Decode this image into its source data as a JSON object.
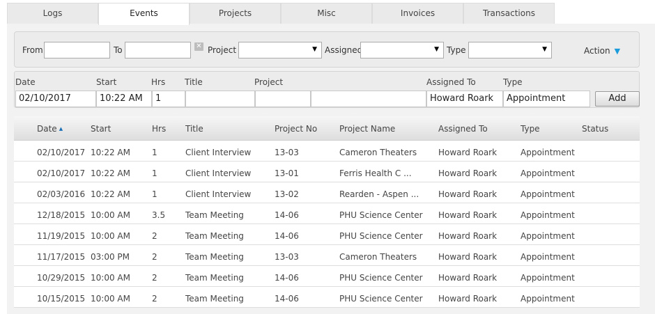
{
  "tabs": [
    "Logs",
    "Events",
    "Projects",
    "Misc",
    "Invoices",
    "Transactions"
  ],
  "active_tab": "Events",
  "filter": {
    "from_label": "From",
    "from_value": "",
    "to_label": "To",
    "to_value": "",
    "clear_icon": "close-icon",
    "project_label": "Project",
    "project_value": "",
    "assigned_label": "Assigned",
    "assigned_value": "",
    "type_label": "Type",
    "type_value": "",
    "action_label": "Action",
    "accent": "#1a9bdc"
  },
  "add_form": {
    "labels": {
      "date": "Date",
      "start": "Start",
      "hrs": "Hrs",
      "title": "Title",
      "project": "Project",
      "assigned": "Assigned To",
      "type": "Type"
    },
    "values": {
      "date": "02/10/2017",
      "start": "10:22 AM",
      "hrs": "1",
      "title": "",
      "project_no": "",
      "project_name": "",
      "assigned": "Howard Roark",
      "type": "Appointment"
    },
    "add_label": "Add"
  },
  "grid": {
    "columns": {
      "date": "Date",
      "start": "Start",
      "hrs": "Hrs",
      "title": "Title",
      "project_no": "Project No",
      "project_name": "Project Name",
      "assigned": "Assigned To",
      "type": "Type",
      "status": "Status"
    },
    "sort_column": "date",
    "sort_direction": "asc",
    "rows": [
      {
        "date": "02/10/2017",
        "start": "10:22 AM",
        "hrs": "1",
        "title": "Client Interview",
        "project_no": "13-03",
        "project_name": "Cameron Theaters",
        "assigned": "Howard Roark",
        "type": "Appointment",
        "status": ""
      },
      {
        "date": "02/10/2017",
        "start": "10:22 AM",
        "hrs": "1",
        "title": "Client Interview",
        "project_no": "13-01",
        "project_name": "Ferris Health C ...",
        "assigned": "Howard Roark",
        "type": "Appointment",
        "status": ""
      },
      {
        "date": "02/03/2016",
        "start": "10:22 AM",
        "hrs": "1",
        "title": "Client Interview",
        "project_no": "13-02",
        "project_name": "Rearden - Aspen ...",
        "assigned": "Howard Roark",
        "type": "Appointment",
        "status": ""
      },
      {
        "date": "12/18/2015",
        "start": "10:00 AM",
        "hrs": "3.5",
        "title": "Team Meeting",
        "project_no": "14-06",
        "project_name": "PHU Science Center",
        "assigned": "Howard Roark",
        "type": "Appointment",
        "status": ""
      },
      {
        "date": "11/19/2015",
        "start": "10:00 AM",
        "hrs": "2",
        "title": "Team Meeting",
        "project_no": "14-06",
        "project_name": "PHU Science Center",
        "assigned": "Howard Roark",
        "type": "Appointment",
        "status": ""
      },
      {
        "date": "11/17/2015",
        "start": "03:00 PM",
        "hrs": "2",
        "title": "Team Meeting",
        "project_no": "13-03",
        "project_name": "Cameron Theaters",
        "assigned": "Howard Roark",
        "type": "Appointment",
        "status": ""
      },
      {
        "date": "10/29/2015",
        "start": "10:00 AM",
        "hrs": "2",
        "title": "Team Meeting",
        "project_no": "14-06",
        "project_name": "PHU Science Center",
        "assigned": "Howard Roark",
        "type": "Appointment",
        "status": ""
      },
      {
        "date": "10/15/2015",
        "start": "10:00 AM",
        "hrs": "2",
        "title": "Team Meeting",
        "project_no": "14-06",
        "project_name": "PHU Science Center",
        "assigned": "Howard Roark",
        "type": "Appointment",
        "status": ""
      }
    ]
  }
}
